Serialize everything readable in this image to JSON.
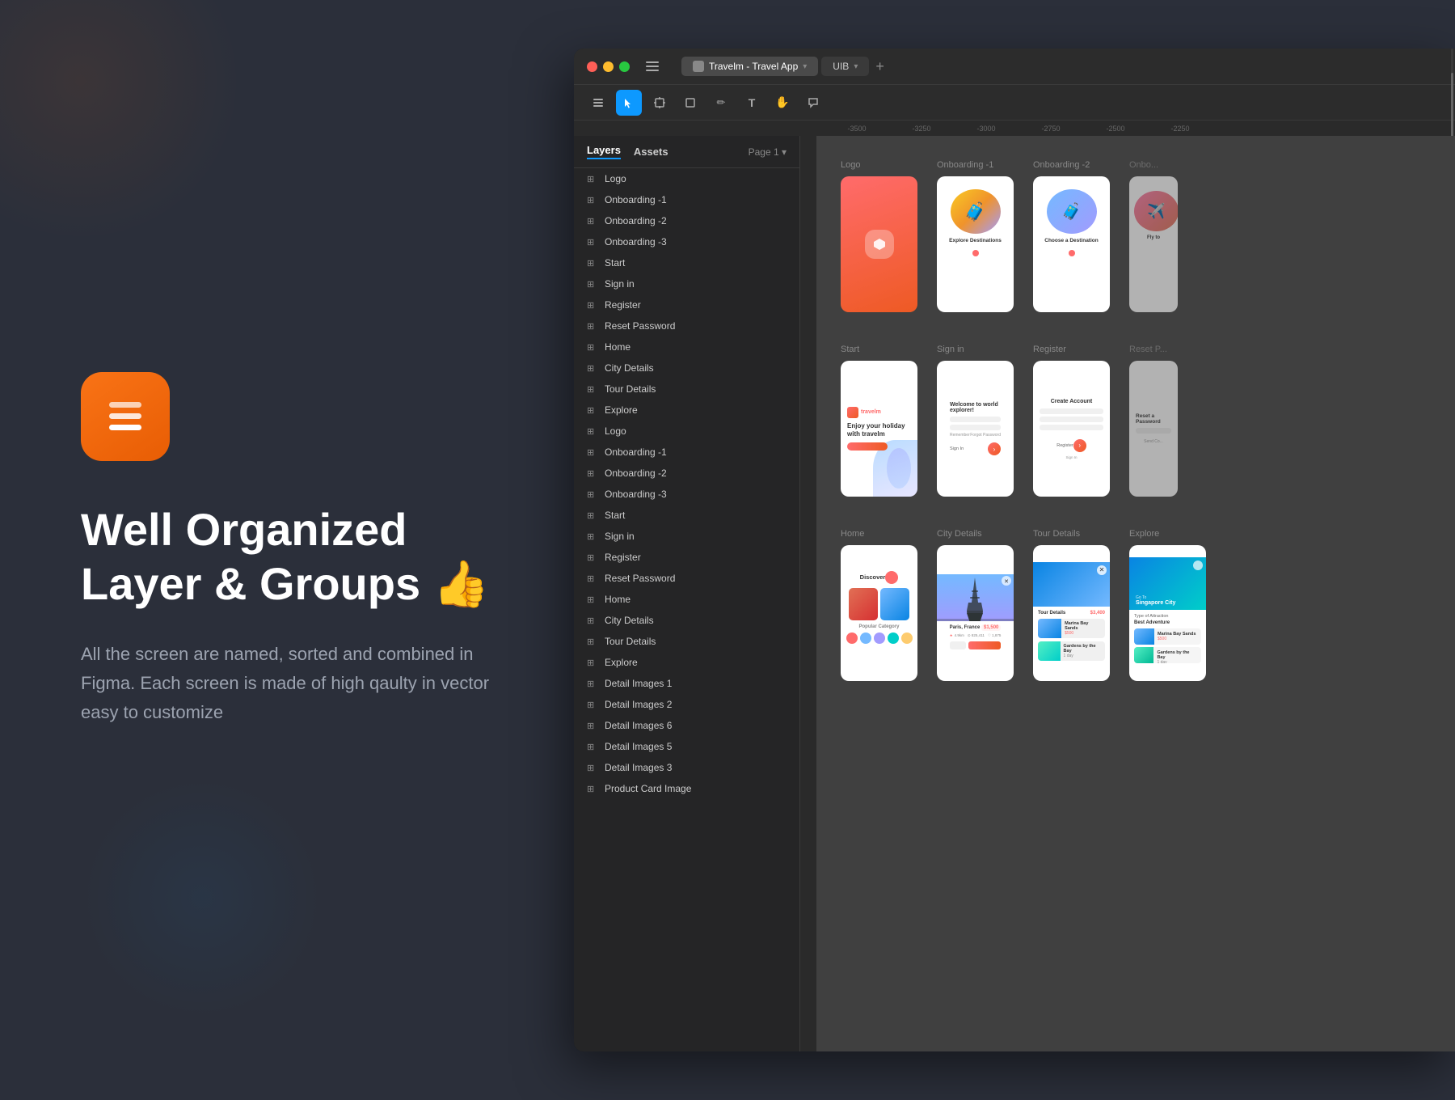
{
  "app": {
    "title": "Well Organized Layer & Groups 👍",
    "subtitle": "All the screen are named, sorted and combined in Figma. Each screen is made of high qaulty in vector easy to customize",
    "icon_alt": "stack layers icon"
  },
  "figma": {
    "window_title": "Travelm - Travel App",
    "tab_label": "UIB",
    "toolbar": {
      "menu": "☰",
      "select": "▶",
      "frame": "⊞",
      "shape": "□",
      "pen": "✏",
      "text": "T",
      "hand": "✋",
      "comment": "💬"
    },
    "ruler_marks": [
      "-3500",
      "-3250",
      "-3000",
      "-2750",
      "-2500",
      "-2250"
    ],
    "layers": {
      "tabs": [
        "Layers",
        "Assets"
      ],
      "page": "Page 1",
      "items": [
        "Logo",
        "Onboarding -1",
        "Onboarding -2",
        "Onboarding -3",
        "Start",
        "Sign in",
        "Register",
        "Reset Password",
        "Home",
        "City Details",
        "Tour Details",
        "Explore",
        "Logo",
        "Onboarding -1",
        "Onboarding -2",
        "Onboarding -3",
        "Start",
        "Sign in",
        "Register",
        "Reset Password",
        "Home",
        "City Details",
        "Tour Details",
        "Explore",
        "Detail Images 1",
        "Detail Images 2",
        "Detail Images 6",
        "Detail Images 5",
        "Detail Images 3",
        "Product Card Image"
      ]
    },
    "canvas": {
      "rows": [
        {
          "frames": [
            "Logo",
            "Onboarding -1",
            "Onboarding -2",
            "Onbo..."
          ]
        },
        {
          "frames": [
            "Start",
            "Sign in",
            "Register",
            "Reset P..."
          ]
        },
        {
          "frames": [
            "Home",
            "City Details",
            "Tour Details",
            "Explore"
          ]
        }
      ]
    }
  }
}
